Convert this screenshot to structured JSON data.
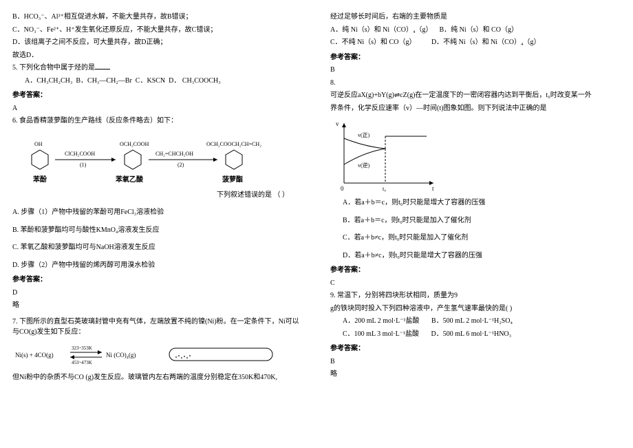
{
  "left": {
    "q4": {
      "optB": "B．HCO₃⁻、Al³⁺相互促进水解，不能大量共存，故B错误；",
      "optC": "C．NO₃⁻、Fe²⁺、H⁺发生氧化还原反应，不能大量共存，故C错误；",
      "optD": "D．该组离子之间不反应，可大量共存，故D正确；",
      "end": "故选D．"
    },
    "q5": {
      "stem": "5. 下列化合物中属于烃的是",
      "optsA": "A．CH₃CH₂CH₃",
      "optsB": "B．CH₃—CH₂—Br",
      "optsC": "C．KSCN",
      "optsD": "D．  CH₃COOCH₃"
    },
    "ansHdr": "参考答案：",
    "q5ans": "A",
    "q6": {
      "stem": "6. 食品香精菠萝酯的生产路线（反应条件略去）如下：",
      "diag": {
        "oh": "OH",
        "midLabel": "OCH₂COOH",
        "rightLabel": "OCH₂COOCH₂CH=CH₂",
        "arrow1top": "ClCH₂COOH",
        "arrow1bot": "(1)",
        "arrow2top": "CH₂=CHCH₂OH",
        "arrow2bot": "(2)",
        "name1": "苯酚",
        "name2": "苯氧乙酸",
        "name3": "菠萝酯"
      },
      "tail": "下列叙述错误的是      （    ）",
      "A": "A. 步骤（1）产物中残留的苯酚可用FeCl₃溶液检验",
      "B": "B. 苯酚和菠萝酯均可与酸性KMnO₄溶液发生反应",
      "C": "C. 苯氧乙酸和菠萝酯均可与NaOH溶液发生反应",
      "D": "D. 步骤（2）产物中残留的烯丙醇可用溴水检验"
    },
    "q6ans": "D",
    "lue": "略",
    "q7": {
      "stem": "7. 下图所示的直型石英玻璃封管中充有气体，左端放置不纯的镍(Ni)粉。在一定条件下，Ni可以与CO(g)发生如下反应：",
      "eq_l": "Ni(s) + 4CO(g)",
      "eq_top": "323~353K",
      "eq_bot": "453~473K",
      "eq_r": "Ni (CO)₄(g)",
      "end": "但Ni粉中的杂质不与CO (g)发生反应。玻璃管内左右两端的温度分别稳定在350K和470K,"
    }
  },
  "right": {
    "q7tail": {
      "l1": "经过足够长时间后，右端的主要物质是",
      "A": "A．纯 Ni（s）和 Ni（CO）₄（g）",
      "B": "B．纯 Ni（s）和 CO（g）",
      "C": "C．不纯 Ni（s）和 CO（g）",
      "D": "D．不纯 Ni（s）和 Ni（CO）₄（g）"
    },
    "ansHdr": "参考答案：",
    "q7ans": "B",
    "q8": {
      "num": "8.",
      "stem1": "可逆反应aX(g)+bY(g)⇌cZ(g)在一定温度下的一密闭容器内达到平衡后，t₀时改变某一外",
      "stem2": "界条件，化学反应速率（v）—时间(t)图象如图。则下列说法中正确的是",
      "axis_y": "v",
      "axis_x": "t",
      "label_vfwd": "v(正)",
      "label_vrev": "v(逆)",
      "label_t0": "t₀",
      "A": "A．若a＋b＝c，则t₀时只能是增大了容器的压强",
      "B": "B．若a＋b＝c，则t₀时只能是加入了催化剂",
      "C": "C．若a＋b≠c，则t₀时只能是加入了催化剂",
      "D": "D．若a＋b≠c，则t₀时只能是增大了容器的压强"
    },
    "q8ans": "C",
    "q9": {
      "l1": "9. 常温下，分别将四块形状相同，质量为9",
      "l2": "g的铁块同时投入下列四种溶液中，产生氢气速率最快的是(      )",
      "A": "A．200 mL 2 mol·L⁻¹盐酸",
      "B": "B．500 mL 2 mol·L⁻¹H₂SO₄",
      "C": "C．100 mL 3 mol·L⁻¹盐酸",
      "D": "D．500 mL 6 mol·L⁻¹HNO₃"
    },
    "q9ans": "B",
    "lue": "略"
  }
}
